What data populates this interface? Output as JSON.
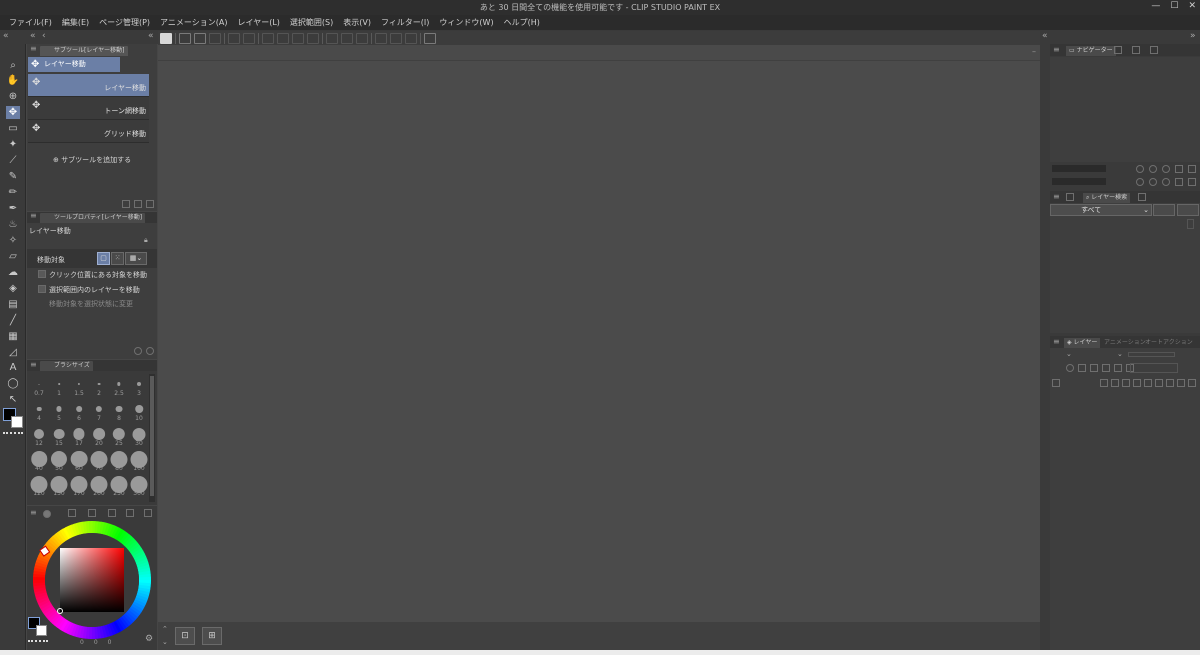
{
  "window": {
    "title": "あと 30 日間全ての機能を使用可能です - CLIP STUDIO PAINT EX",
    "controls": [
      "minimize",
      "maximize",
      "close"
    ]
  },
  "menu": {
    "items": [
      "ファイル(F)",
      "編集(E)",
      "ページ管理(P)",
      "アニメーション(A)",
      "レイヤー(L)",
      "選択範囲(S)",
      "表示(V)",
      "フィルター(I)",
      "ウィンドウ(W)",
      "ヘルプ(H)"
    ]
  },
  "subtool_panel": {
    "tab_label": "サブツール[レイヤー移動]",
    "group_label": "レイヤー移動",
    "items": [
      "レイヤー移動",
      "トーン網移動",
      "グリッド移動"
    ],
    "add_label": "サブツールを追加する"
  },
  "tool_property": {
    "tab_label": "ツールプロパティ[レイヤー移動]",
    "tool_name": "レイヤー移動",
    "move_target_label": "移動対象",
    "options": [
      "クリック位置にある対象を移動",
      "選択範囲内のレイヤーを移動",
      "移動対象を選択状態に変更"
    ]
  },
  "brush_size": {
    "tab_label": "ブラシサイズ",
    "sizes": [
      "0.7",
      "1",
      "1.5",
      "2",
      "2.5",
      "3",
      "4",
      "5",
      "6",
      "7",
      "8",
      "10",
      "12",
      "15",
      "17",
      "20",
      "25",
      "30",
      "40",
      "50",
      "60",
      "70",
      "80",
      "100",
      "120",
      "150",
      "170",
      "200",
      "250",
      "300"
    ]
  },
  "right_panels": {
    "navigator_tab": "ナビゲーター",
    "layer_search_tab": "レイヤー検索",
    "layer_search_filter": "すべて",
    "layer_tab": "レイヤー",
    "tab2": "アニメーション",
    "tab3": "オートアクション"
  },
  "colors": {
    "accent": "#6b7fa6",
    "main_color": "#000000",
    "sub_color": "#ffffff"
  },
  "color_slider_footer": [
    "0",
    "0",
    "0"
  ]
}
